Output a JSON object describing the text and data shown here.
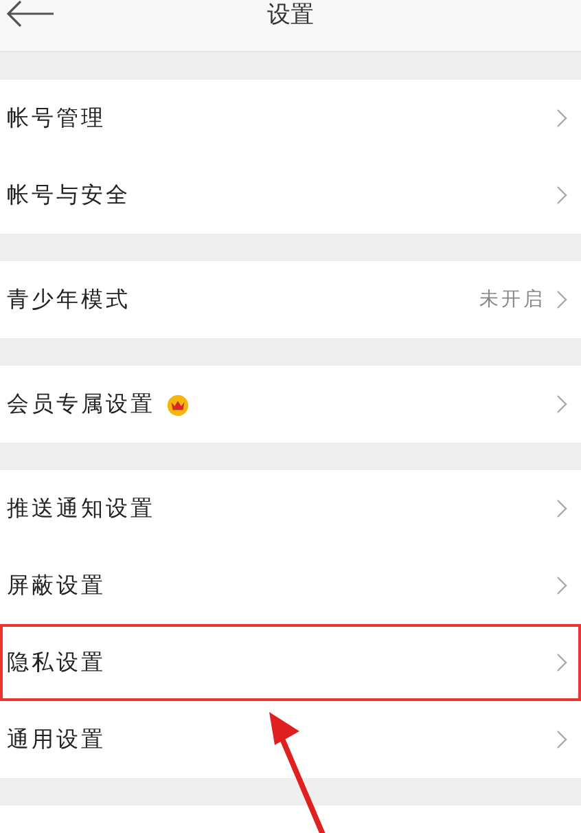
{
  "header": {
    "title": "设置"
  },
  "sections": [
    {
      "rows": [
        {
          "label": "帐号管理",
          "highlighted": false
        },
        {
          "label": "帐号与安全",
          "highlighted": false
        }
      ]
    },
    {
      "rows": [
        {
          "label": "青少年模式",
          "value": "未开启",
          "highlighted": false
        }
      ]
    },
    {
      "rows": [
        {
          "label": "会员专属设置",
          "crown": true,
          "highlighted": false
        }
      ]
    },
    {
      "rows": [
        {
          "label": "推送通知设置",
          "highlighted": false
        },
        {
          "label": "屏蔽设置",
          "highlighted": false
        },
        {
          "label": "隐私设置",
          "highlighted": true
        },
        {
          "label": "通用设置",
          "highlighted": false
        }
      ]
    }
  ]
}
